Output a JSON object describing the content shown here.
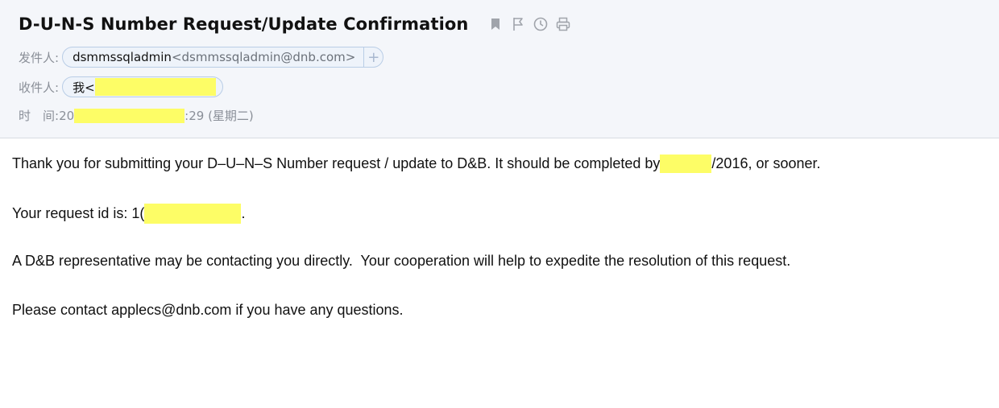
{
  "email": {
    "subject": "D-U-N-S Number Request/Update Confirmation",
    "toolbar": {
      "icons": [
        "bookmark-icon",
        "flag-icon",
        "clock-icon",
        "print-icon"
      ]
    },
    "from": {
      "label": "发件人:",
      "name": "dsmmssqladmin",
      "address": "<dsmmssqladmin@dnb.com>",
      "add_symbol": "+"
    },
    "to": {
      "label": "收件人:",
      "name": "我<"
    },
    "time": {
      "label": "时　间:",
      "prefix": "20",
      "suffix": ":29 (星期二)"
    }
  },
  "body": {
    "para1_start": "Thank you for submitting your D–U–N–S Number request / update to D&B. It should be completed by",
    "para1_end": "/2016, or sooner.",
    "para2_start": "Your request id is: 1(",
    "para2_end": ".",
    "para3": "A D&B representative may be contacting you directly.  Your cooperation will help to expedite the resolution of this request.",
    "para4": "Please contact applecs@dnb.com if you have any questions."
  },
  "colors": {
    "highlight": "#fdfd66",
    "header_bg": "#f4f6fa",
    "chip_border": "#b9cde6"
  }
}
